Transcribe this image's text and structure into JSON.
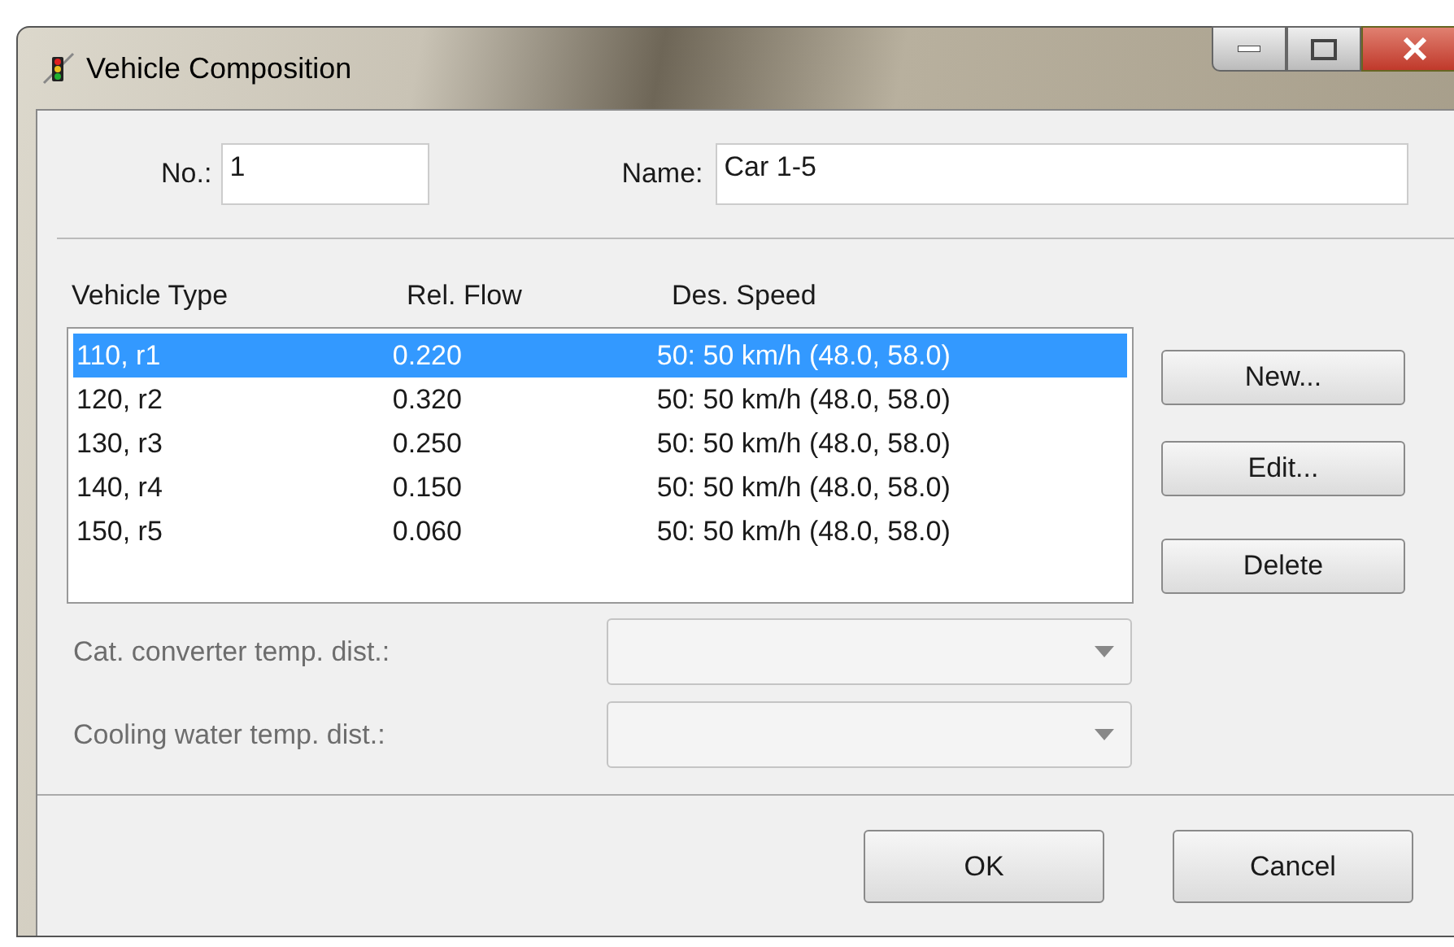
{
  "window": {
    "title": "Vehicle Composition"
  },
  "fields": [
    {
      "label": "No.:",
      "value": "1"
    },
    {
      "label": "Name:",
      "value": "Car 1-5"
    }
  ],
  "table": {
    "columns": [
      "Vehicle Type",
      "Rel. Flow",
      "Des. Speed"
    ],
    "rows": [
      {
        "cells": [
          "110, r1",
          "0.220",
          "50: 50 km/h (48.0, 58.0)"
        ],
        "selected": true
      },
      {
        "cells": [
          "120, r2",
          "0.320",
          "50: 50 km/h (48.0, 58.0)"
        ],
        "selected": false
      },
      {
        "cells": [
          "130, r3",
          "0.250",
          "50: 50 km/h (48.0, 58.0)"
        ],
        "selected": false
      },
      {
        "cells": [
          "140, r4",
          "0.150",
          "50: 50 km/h (48.0, 58.0)"
        ],
        "selected": false
      },
      {
        "cells": [
          "150, r5",
          "0.060",
          "50: 50 km/h (48.0, 58.0)"
        ],
        "selected": false
      }
    ]
  },
  "side_buttons": [
    "New...",
    "Edit...",
    "Delete"
  ],
  "dropdowns": [
    {
      "label": "Cat. converter temp. dist.:",
      "disabled": true
    },
    {
      "label": "Cooling water temp. dist.:",
      "disabled": true
    }
  ],
  "buttons": [
    "OK",
    "Cancel"
  ]
}
